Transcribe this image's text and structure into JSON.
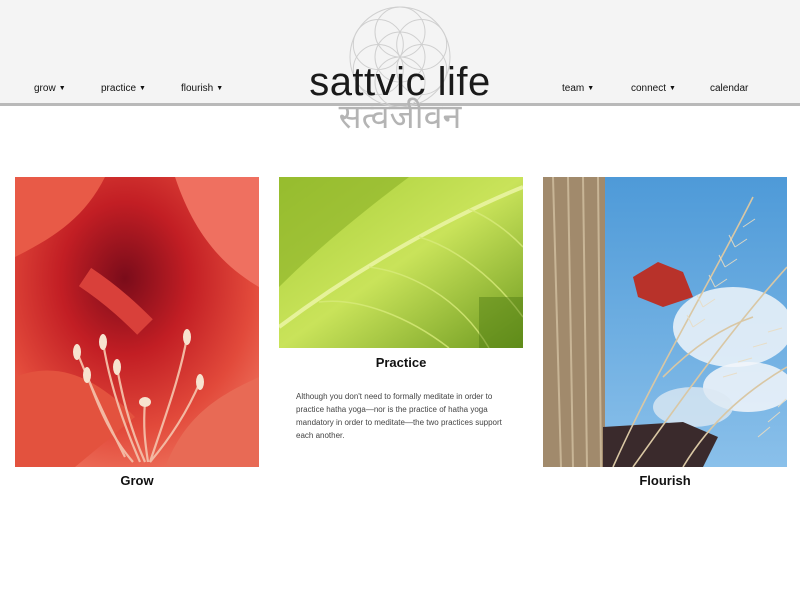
{
  "nav": {
    "left": [
      {
        "label": "grow",
        "has_dropdown": true
      },
      {
        "label": "practice",
        "has_dropdown": true
      },
      {
        "label": "flourish",
        "has_dropdown": true
      }
    ],
    "right": [
      {
        "label": "team",
        "has_dropdown": true
      },
      {
        "label": "connect",
        "has_dropdown": true
      },
      {
        "label": "calendar",
        "has_dropdown": false
      }
    ],
    "caret_icon": "caret-down-icon"
  },
  "logo": {
    "text": "sattvic life",
    "script": "सत्वजीवन"
  },
  "cards": [
    {
      "title": "Grow",
      "image": "red-amaryllis-flower-photo"
    },
    {
      "title": "Practice",
      "image": "green-leaf-photo",
      "body": "Although you don't need to formally meditate in order to practice hatha yoga—nor is the practice of hatha yoga mandatory in order to meditate—the two practices support each another."
    },
    {
      "title": "Flourish",
      "image": "grass-plumes-sky-photo"
    }
  ],
  "colors": {
    "header_bg": "#f4f4f4",
    "header_rule": "#b9b9b9",
    "logo_script": "#b4b4b4"
  }
}
